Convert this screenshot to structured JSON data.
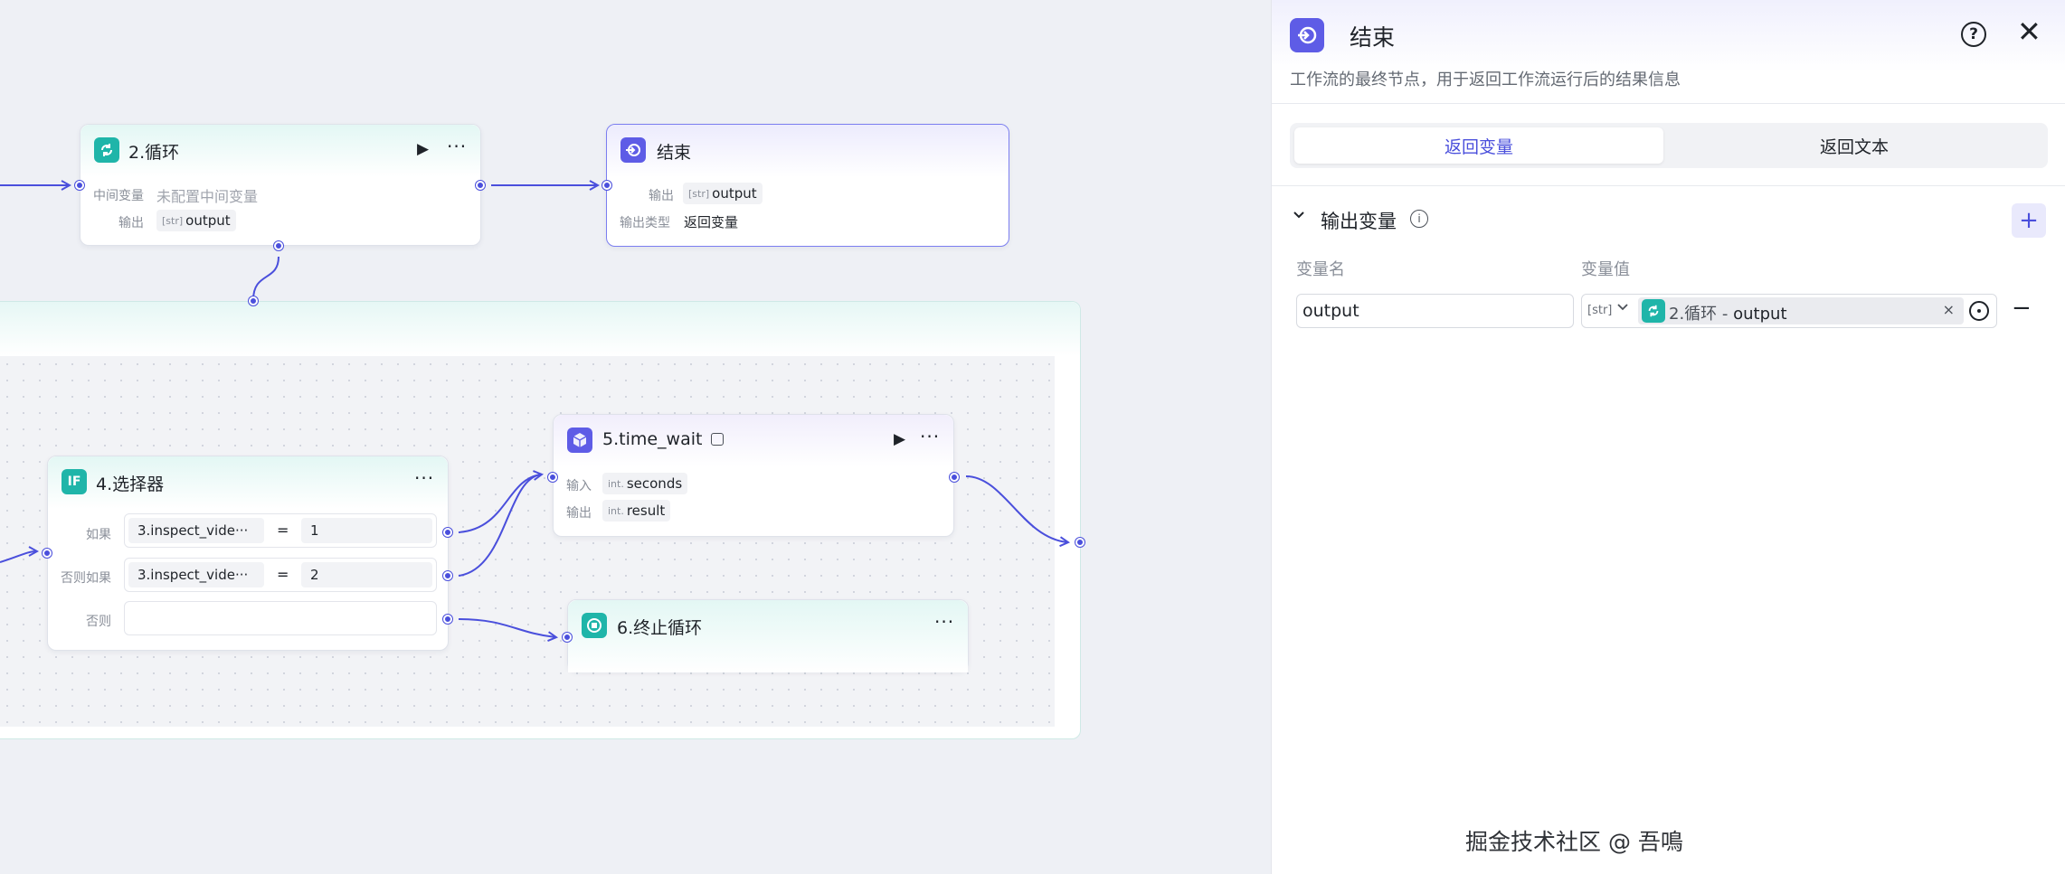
{
  "canvas": {
    "node_loop": {
      "title": "2.循环",
      "mid_var_label": "中间变量",
      "mid_var_value": "未配置中间变量",
      "output_label": "输出",
      "output_type": "[str]",
      "output_name": "output"
    },
    "node_end": {
      "title": "结束",
      "output_label": "输出",
      "output_type": "[str]",
      "output_name": "output",
      "output_kind_label": "输出类型",
      "output_kind_value": "返回变量"
    },
    "node_selector": {
      "icon_text": "IF",
      "title": "4.选择器",
      "if_label": "如果",
      "if_left": "3.inspect_vide···",
      "if_op": "=",
      "if_right": "1",
      "elif_label": "否则如果",
      "elif_left": "3.inspect_vide···",
      "elif_op": "=",
      "elif_right": "2",
      "else_label": "否则"
    },
    "node_wait": {
      "title": "5.time_wait",
      "input_label": "输入",
      "input_type": "int.",
      "input_name": "seconds",
      "output_label": "输出",
      "output_type": "int.",
      "output_name": "result"
    },
    "node_break": {
      "title": "6.终止循环"
    }
  },
  "panel": {
    "title": "结束",
    "description": "工作流的最终节点，用于返回工作流运行后的结果信息",
    "help": "?",
    "close": "✕",
    "tabs": [
      "返回变量",
      "返回文本"
    ],
    "section_title": "输出变量",
    "info": "i",
    "add": "+",
    "col_name": "变量名",
    "col_value": "变量值",
    "row": {
      "name": "output",
      "type": "[str]",
      "ref_node": "2.循环 - ",
      "ref_var": "output",
      "clear": "×",
      "remove": "−"
    }
  },
  "watermark": "掘金技术社区 @ 吾鳴",
  "colors": {
    "accent": "#4a4fdc",
    "teal": "#1fb5a9",
    "purple": "#5e5ce6"
  }
}
